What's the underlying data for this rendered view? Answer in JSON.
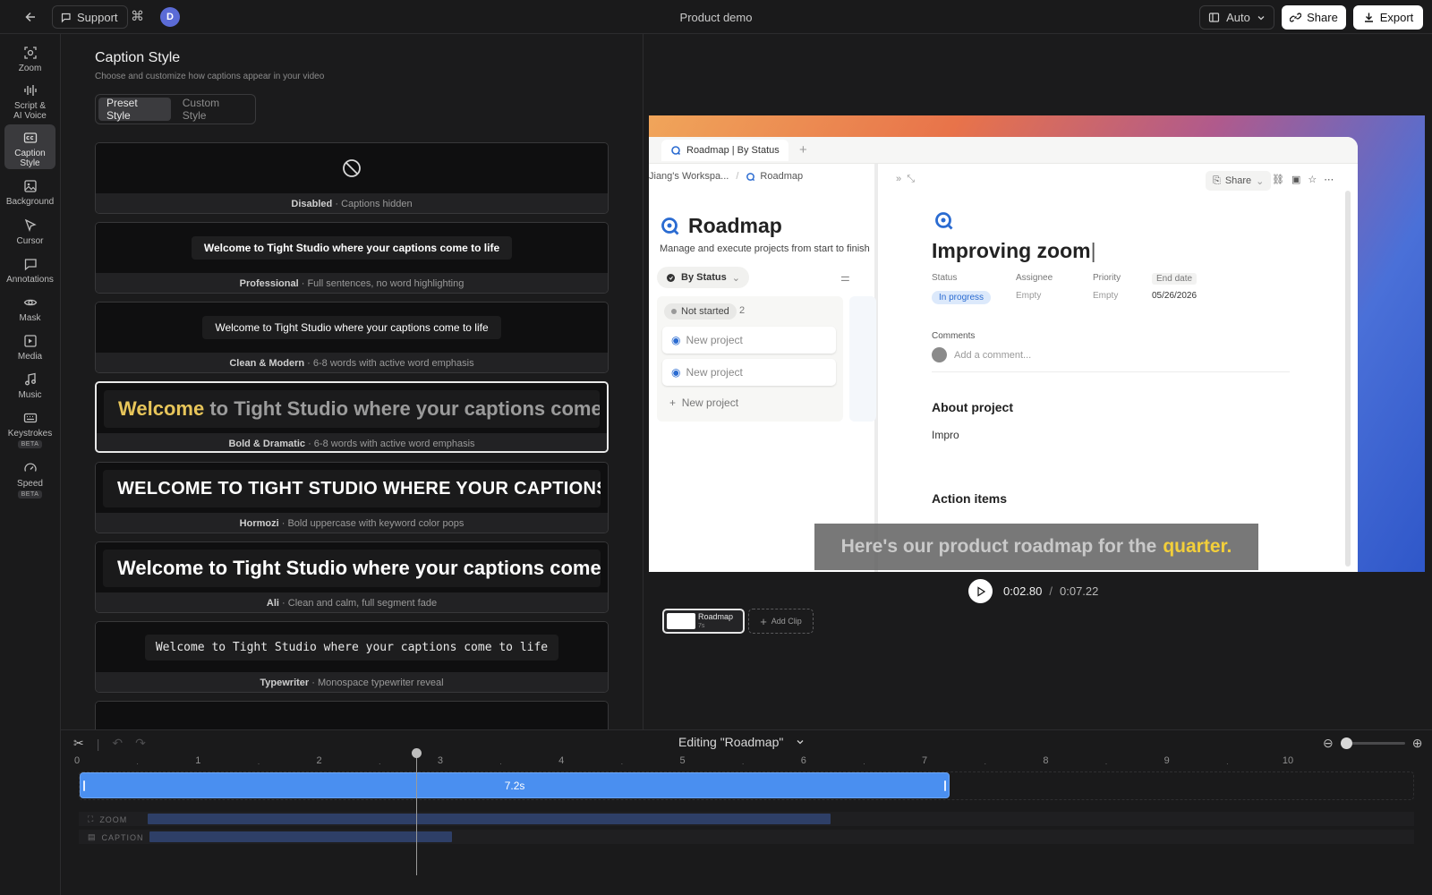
{
  "topbar": {
    "support_label": "Support",
    "avatar_initial": "D",
    "project_title": "Product demo",
    "auto_label": "Auto",
    "share_label": "Share",
    "export_label": "Export"
  },
  "rail": {
    "items": [
      {
        "label": "Zoom",
        "icon": "zoom-icon"
      },
      {
        "label": "Script &",
        "label2": "AI Voice",
        "icon": "waveform-icon"
      },
      {
        "label": "Caption",
        "label2": "Style",
        "icon": "caption-icon",
        "active": true
      },
      {
        "label": "Background",
        "icon": "image-icon"
      },
      {
        "label": "Cursor",
        "icon": "cursor-icon"
      },
      {
        "label": "Annotations",
        "icon": "comment-icon"
      },
      {
        "label": "Mask",
        "icon": "eye-icon"
      },
      {
        "label": "Media",
        "icon": "media-icon"
      },
      {
        "label": "Music",
        "icon": "music-icon"
      },
      {
        "label": "Keystrokes",
        "badge": "BETA",
        "icon": "keyboard-icon"
      },
      {
        "label": "Speed",
        "badge": "BETA",
        "icon": "speedometer-icon"
      }
    ]
  },
  "panel": {
    "title": "Caption Style",
    "subtitle": "Choose and customize how captions appear in your video",
    "tabs": [
      "Preset Style",
      "Custom Style"
    ],
    "sample_text": "Welcome to Tight Studio where your captions come to life",
    "bold_highlight": "Welcome",
    "bold_rest": "to Tight Studio where your captions come to life",
    "hormozi_text": "WELCOME TO TIGHT STUDIO WHERE YOUR CAPTIONS COME TO LIFE",
    "presets": [
      {
        "name": "Disabled",
        "desc": "Captions hidden"
      },
      {
        "name": "Professional",
        "desc": "Full sentences, no word highlighting"
      },
      {
        "name": "Clean & Modern",
        "desc": "6-8 words with active word emphasis"
      },
      {
        "name": "Bold & Dramatic",
        "desc": "6-8 words with active word emphasis"
      },
      {
        "name": "Hormozi",
        "desc": "Bold uppercase with keyword color pops"
      },
      {
        "name": "Ali",
        "desc": "Clean and calm, full segment fade"
      },
      {
        "name": "Typewriter",
        "desc": "Monospace typewriter reveal"
      }
    ]
  },
  "preview": {
    "tab_label": "Roadmap | By Status",
    "crumb_workspace": "Jiang's Workspa...",
    "crumb_page": "Roadmap",
    "share_label": "Share",
    "roadmap_title": "Roadmap",
    "roadmap_sub": "Manage and execute projects from start to finish",
    "by_status": "By Status",
    "not_started": "Not started",
    "not_started_count": "2",
    "new_project": "New project",
    "doc_title": "Improving zoom",
    "props": {
      "status_l": "Status",
      "status_v": "In progress",
      "assignee_l": "Assignee",
      "assignee_v": "Empty",
      "priority_l": "Priority",
      "priority_v": "Empty",
      "enddate_l": "End date",
      "enddate_v": "05/26/2026"
    },
    "comments_l": "Comments",
    "add_comment": "Add a comment...",
    "about_project": "About project",
    "about_text": "Impro",
    "action_items": "Action items",
    "caption_pre": "Here's our product roadmap for the",
    "caption_hl": "quarter."
  },
  "player": {
    "current_time": "0:02.80",
    "sep": "/",
    "total_time": "0:07.22"
  },
  "clips": {
    "clip_name": "Roadmap",
    "clip_dur": "7s",
    "add_clip": "Add Clip"
  },
  "timeline": {
    "editing_label": "Editing \"Roadmap\"",
    "ticks": [
      "0",
      "1",
      "2",
      "3",
      "4",
      "5",
      "6",
      "7",
      "8",
      "9",
      "10"
    ],
    "clip_duration": "7.2s",
    "playhead_seconds": 2.8,
    "clip_seconds": 7.2,
    "zoom_track_seconds": 6.2,
    "caption_track_seconds": 2.5,
    "zoom_row": "ZOOM",
    "caption_row": "CAPTION"
  }
}
